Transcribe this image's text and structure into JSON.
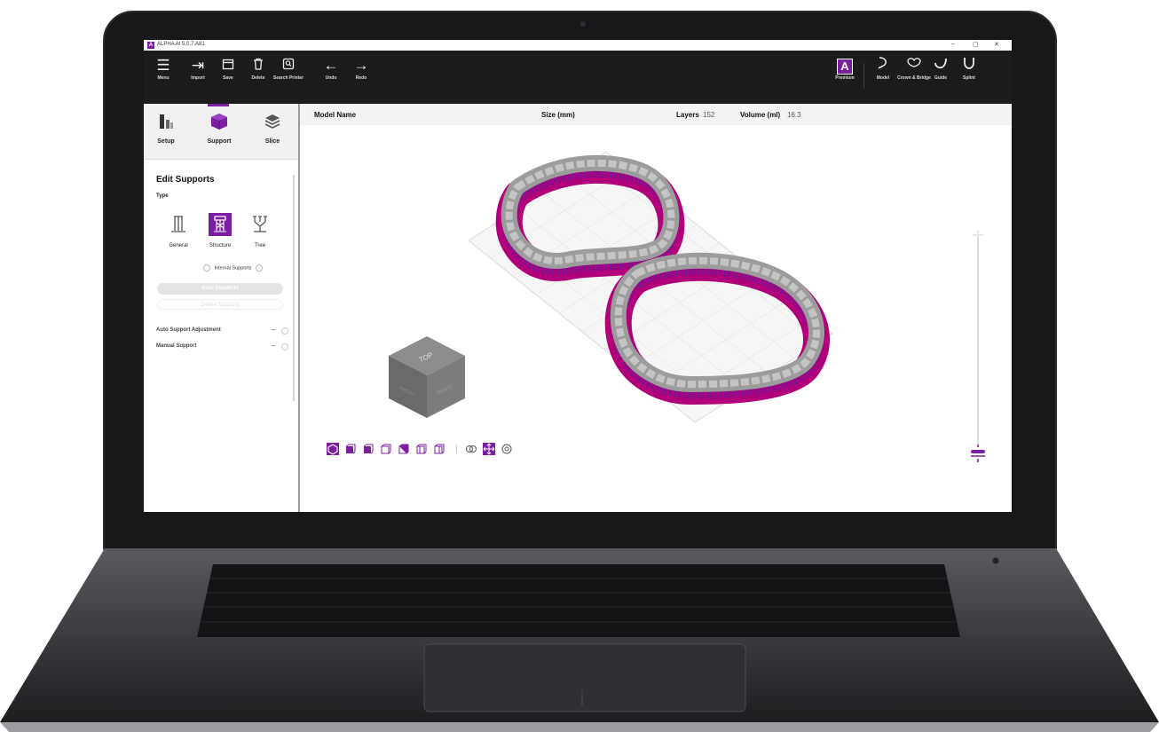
{
  "window": {
    "title": "ALPHA AI 5.0.7.A81",
    "minimize": "–",
    "maximize": "▢",
    "close": "✕"
  },
  "toolbar": {
    "left": [
      {
        "label": "Menu",
        "icon": "menu-icon"
      },
      {
        "label": "Import",
        "icon": "import-icon"
      },
      {
        "label": "Save",
        "icon": "save-icon"
      },
      {
        "label": "Delete",
        "icon": "trash-icon"
      },
      {
        "label": "Search Printer",
        "icon": "search-printer-icon"
      },
      {
        "label": "Undo",
        "icon": "undo-arrow-icon"
      },
      {
        "label": "Redo",
        "icon": "redo-arrow-icon"
      }
    ],
    "right": [
      {
        "label": "Premium",
        "icon": "premium-logo-icon"
      },
      {
        "label": "Model",
        "icon": "model-icon"
      },
      {
        "label": "Crown & Bridge",
        "icon": "crown-bridge-icon"
      },
      {
        "label": "Guide",
        "icon": "guide-icon"
      },
      {
        "label": "Splint",
        "icon": "splint-icon"
      }
    ]
  },
  "tabs": [
    {
      "label": "Setup",
      "icon": "setup-icon"
    },
    {
      "label": "Support",
      "icon": "support-cube-icon",
      "active": true
    },
    {
      "label": "Slice",
      "icon": "slice-layers-icon"
    }
  ],
  "edit_supports": {
    "title": "Edit Supports",
    "type_label": "Type",
    "types": [
      {
        "label": "General",
        "icon": "general-support-icon"
      },
      {
        "label": "Structure",
        "icon": "structure-support-icon",
        "selected": true
      },
      {
        "label": "Tree",
        "icon": "tree-support-icon"
      }
    ],
    "internal_supports": "Internal Supports",
    "auto_supports_button": "Auto Supports",
    "delete_supports_button": "Delete Supports",
    "auto_support_adjustment": "Auto Support Adjustment",
    "manual_support": "Manual Support",
    "collapse_symbol": "–"
  },
  "info_bar": {
    "model_name_label": "Model Name",
    "size_label": "Size (mm)",
    "layers_label": "Layers",
    "layers_value": "152",
    "volume_label": "Volume (ml)",
    "volume_value": "16.3"
  },
  "view_cube": {
    "top": "TOP",
    "front": "FRONT",
    "right": "RIGHT"
  },
  "colors": {
    "accent": "#7b1fa2",
    "toolbar_bg": "#1c1c1e",
    "support_magenta": "#b0007a",
    "model_gray": "#9c9c9c"
  }
}
